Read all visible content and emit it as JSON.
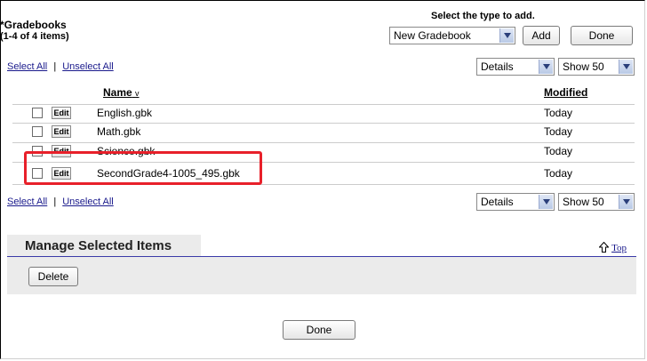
{
  "header": {
    "title": "*Gradebooks",
    "count": "(1-4 of 4 items)",
    "select_type_label": "Select the type to add.",
    "type_select_value": "New Gradebook",
    "add_label": "Add",
    "done_label": "Done"
  },
  "selection": {
    "select_all": "Select All",
    "separator": "|",
    "unselect_all": "Unselect All"
  },
  "view_controls": {
    "view_value": "Details",
    "page_size_value": "Show 50"
  },
  "table": {
    "columns": {
      "name": "Name",
      "sort_arrow": "v",
      "modified": "Modified"
    },
    "edit_label": "Edit",
    "rows": [
      {
        "name": "English.gbk",
        "modified": "Today"
      },
      {
        "name": "Math.gbk",
        "modified": "Today"
      },
      {
        "name": "Science.gbk",
        "modified": "Today"
      },
      {
        "name": "SecondGrade4-1005_495.gbk",
        "modified": "Today"
      }
    ]
  },
  "manage": {
    "title": "Manage Selected Items",
    "top_label": "Top",
    "delete_label": "Delete"
  },
  "footer": {
    "done_label": "Done"
  },
  "colors": {
    "highlight_box": "#e8202a",
    "section_rule": "#3a3aa8",
    "panel_bg": "#ebebeb",
    "link": "#1a1a8c"
  }
}
